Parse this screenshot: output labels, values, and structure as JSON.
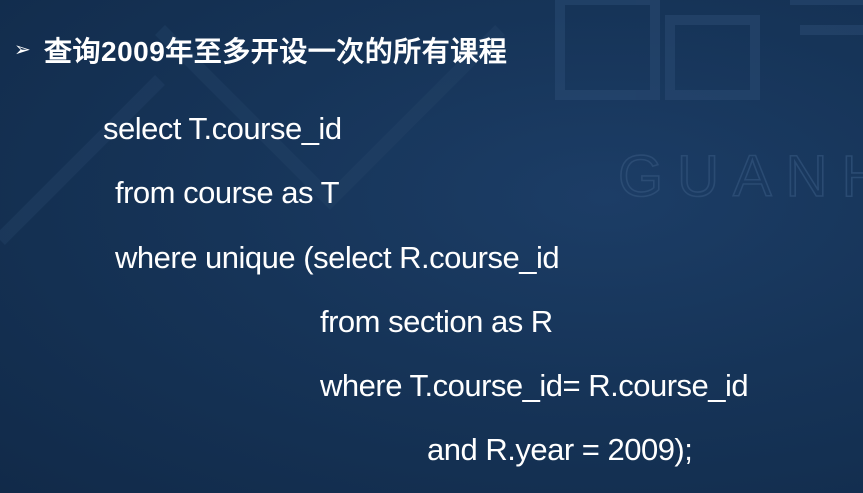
{
  "slide": {
    "bullet_marker": "➢",
    "heading": "查询2009年至多开设一次的所有课程",
    "code_lines": [
      "select T.course_id",
      "from course as T",
      "where unique (select R.course_id",
      "from section as R",
      "where T.course_id= R.course_id",
      "and R.year = 2009);"
    ],
    "watermark": {
      "text": "GUANH",
      "color": "#2a4a72"
    },
    "colors": {
      "background": "#163458",
      "text": "#ffffff"
    }
  }
}
